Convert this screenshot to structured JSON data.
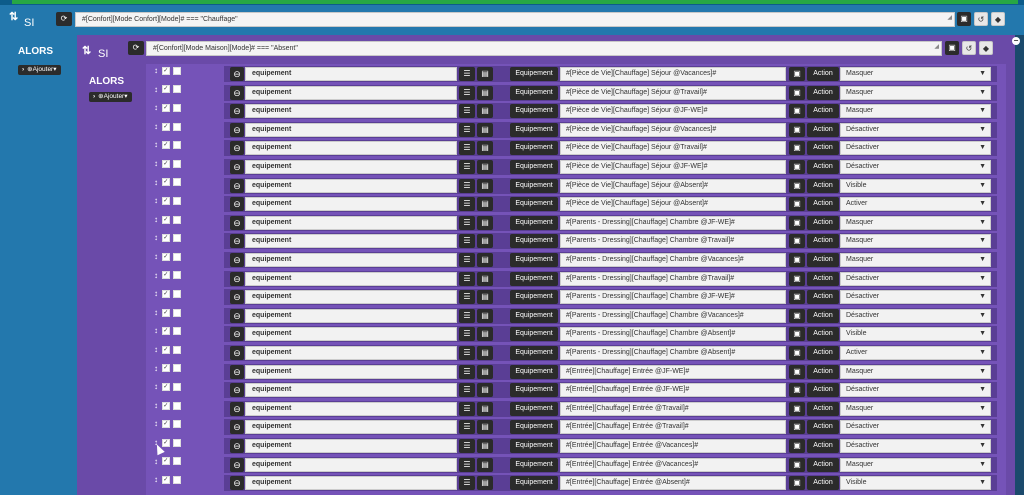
{
  "outer": {
    "si_label": "SI",
    "condition": "#[Confort][Mode Confort][Mode]# === \"Chauffage\"",
    "alors_label": "ALORS",
    "add_label": "Ajouter"
  },
  "inner": {
    "si_label": "SI",
    "condition": "#[Confort][Mode Maison][Mode]# === \"Absent\"",
    "alors_label": "ALORS",
    "add_label": "Ajouter"
  },
  "labels": {
    "equipement_value": "equipement",
    "equipement_btn": "Equipement",
    "action_btn": "Action"
  },
  "icons": {
    "refresh": "refresh-icon",
    "code": "code-icon",
    "history": "history-icon",
    "cube": "cube-icon",
    "list": "list-icon",
    "bars": "bars-icon",
    "remove": "minus-circle-icon",
    "move": "move-icon"
  },
  "actions": [
    {
      "cmd": "#[Pièce de Vie][Chauffage] Séjour @Vacances]#",
      "action": "Masquer"
    },
    {
      "cmd": "#[Pièce de Vie][Chauffage] Séjour @Travail]#",
      "action": "Masquer"
    },
    {
      "cmd": "#[Pièce de Vie][Chauffage] Séjour @JF-WE]#",
      "action": "Masquer"
    },
    {
      "cmd": "#[Pièce de Vie][Chauffage] Séjour @Vacances]#",
      "action": "Désactiver"
    },
    {
      "cmd": "#[Pièce de Vie][Chauffage] Séjour @Travail]#",
      "action": "Désactiver"
    },
    {
      "cmd": "#[Pièce de Vie][Chauffage] Séjour @JF-WE]#",
      "action": "Désactiver"
    },
    {
      "cmd": "#[Pièce de Vie][Chauffage] Séjour @Absent]#",
      "action": "Visible"
    },
    {
      "cmd": "#[Pièce de Vie][Chauffage] Séjour @Absent]#",
      "action": "Activer"
    },
    {
      "cmd": "#[Parents - Dressing][Chauffage] Chambre @JF-WE]#",
      "action": "Masquer"
    },
    {
      "cmd": "#[Parents - Dressing][Chauffage] Chambre @Travail]#",
      "action": "Masquer"
    },
    {
      "cmd": "#[Parents - Dressing][Chauffage] Chambre @Vacances]#",
      "action": "Masquer"
    },
    {
      "cmd": "#[Parents - Dressing][Chauffage] Chambre @Travail]#",
      "action": "Désactiver"
    },
    {
      "cmd": "#[Parents - Dressing][Chauffage] Chambre @JF-WE]#",
      "action": "Désactiver"
    },
    {
      "cmd": "#[Parents - Dressing][Chauffage] Chambre @Vacances]#",
      "action": "Désactiver"
    },
    {
      "cmd": "#[Parents - Dressing][Chauffage] Chambre @Absent]#",
      "action": "Visible"
    },
    {
      "cmd": "#[Parents - Dressing][Chauffage] Chambre @Absent]#",
      "action": "Activer"
    },
    {
      "cmd": "#[Entrée][Chauffage] Entrée @JF-WE]#",
      "action": "Masquer"
    },
    {
      "cmd": "#[Entrée][Chauffage] Entrée @JF-WE]#",
      "action": "Désactiver"
    },
    {
      "cmd": "#[Entrée][Chauffage] Entrée @Travail]#",
      "action": "Masquer"
    },
    {
      "cmd": "#[Entrée][Chauffage] Entrée @Travail]#",
      "action": "Désactiver"
    },
    {
      "cmd": "#[Entrée][Chauffage] Entrée @Vacances]#",
      "action": "Désactiver"
    },
    {
      "cmd": "#[Entrée][Chauffage] Entrée @Vacances]#",
      "action": "Masquer"
    },
    {
      "cmd": "#[Entrée][Chauffage] Entrée @Absent]#",
      "action": "Visible"
    }
  ]
}
